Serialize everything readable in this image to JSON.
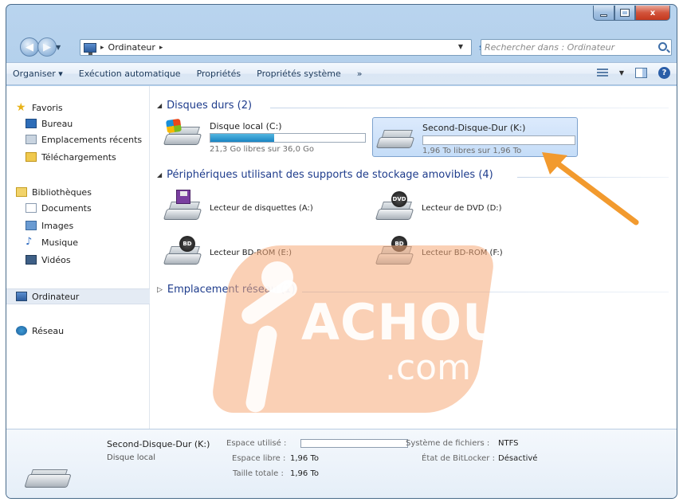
{
  "window": {
    "buttons": {
      "minimize": "",
      "maximize": "",
      "close": "x"
    }
  },
  "address": {
    "crumbs": [
      "Ordinateur"
    ],
    "search_placeholder": "Rechercher dans : Ordinateur"
  },
  "toolbar": {
    "organize": "Organiser ▾",
    "autoplay": "Exécution automatique",
    "properties": "Propriétés",
    "system_properties": "Propriétés système",
    "more": "»"
  },
  "sidebar": {
    "favorites": "Favoris",
    "desktop": "Bureau",
    "recent": "Emplacements récents",
    "downloads": "Téléchargements",
    "libraries": "Bibliothèques",
    "documents": "Documents",
    "images": "Images",
    "music": "Musique",
    "videos": "Vidéos",
    "computer": "Ordinateur",
    "network": "Réseau"
  },
  "groups": {
    "hard_disks": "Disques durs (2)",
    "removable": "Périphériques utilisant des supports de stockage amovibles (4)",
    "network": "Emplacement réseau (1)"
  },
  "drives": {
    "c": {
      "name": "Disque local (C:)",
      "free": "21,3 Go libres sur 36,0 Go",
      "used_fraction": 0.41
    },
    "k": {
      "name": "Second-Disque-Dur (K:)",
      "free": "1,96 To libres sur 1,96 To",
      "used_fraction": 0.0
    },
    "a": {
      "name": "Lecteur de disquettes (A:)"
    },
    "d": {
      "name": "Lecteur de DVD (D:)",
      "badge": "DVD"
    },
    "e": {
      "name": "Lecteur BD-ROM (E:)",
      "badge": "BD"
    },
    "f": {
      "name": "Lecteur BD-ROM (F:)",
      "badge": "BD"
    }
  },
  "watermark": {
    "text": "ACHOURI",
    "com": ".com"
  },
  "details": {
    "name": "Second-Disque-Dur (K:)",
    "type": "Disque local",
    "used_label": "Espace utilisé :",
    "free_label": "Espace libre :",
    "free_value": "1,96 To",
    "total_label": "Taille totale :",
    "total_value": "1,96 To",
    "fs_label": "Système de fichiers :",
    "fs_value": "NTFS",
    "bitlocker_label": "État de BitLocker :",
    "bitlocker_value": "Désactivé",
    "used_fraction": 0.0
  },
  "colors": {
    "accent": "#1a85c2",
    "group_header": "#1e3c8c",
    "arrow": "#f29a2e"
  }
}
